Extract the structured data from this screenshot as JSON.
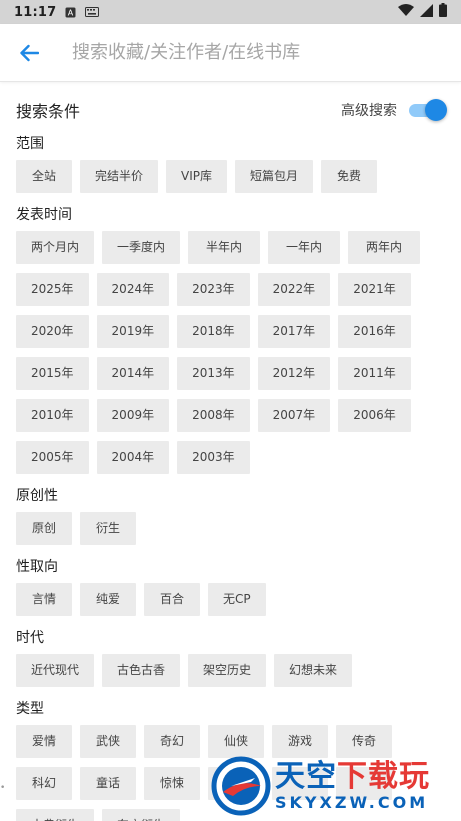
{
  "status_bar": {
    "time": "11:17"
  },
  "toolbar": {
    "search_placeholder": "搜索收藏/关注作者/在线书库"
  },
  "conditions": {
    "title": "搜索条件",
    "advanced_label": "高级搜索",
    "advanced_on": true
  },
  "sections": {
    "scope": {
      "title": "范围",
      "items": [
        "全站",
        "完结半价",
        "VIP库",
        "短篇包月",
        "免费"
      ]
    },
    "time": {
      "title": "发表时间",
      "items": [
        "两个月内",
        "一季度内",
        "半年内",
        "一年内",
        "两年内",
        "2025年",
        "2024年",
        "2023年",
        "2022年",
        "2021年",
        "2020年",
        "2019年",
        "2018年",
        "2017年",
        "2016年",
        "2015年",
        "2014年",
        "2013年",
        "2012年",
        "2011年",
        "2010年",
        "2009年",
        "2008年",
        "2007年",
        "2006年",
        "2005年",
        "2004年",
        "2003年"
      ]
    },
    "originality": {
      "title": "原创性",
      "items": [
        "原创",
        "衍生"
      ]
    },
    "orientation": {
      "title": "性取向",
      "items": [
        "言情",
        "纯爱",
        "百合",
        "无CP"
      ]
    },
    "era": {
      "title": "时代",
      "items": [
        "近代现代",
        "古色古香",
        "架空历史",
        "幻想未来"
      ]
    },
    "genre": {
      "title": "类型",
      "items": [
        "爱情",
        "武侠",
        "奇幻",
        "仙侠",
        "游戏",
        "传奇",
        "科幻",
        "童话",
        "惊悚",
        "",
        "",
        "",
        "古典衍生",
        "东方衍生"
      ]
    }
  },
  "watermark": {
    "cn_main": "天空",
    "cn_accent": "下载玩",
    "en": "SKYXZW.COM"
  },
  "colors": {
    "accent": "#1e88e5",
    "chip_bg": "#ebebeb",
    "status_bar": "#d4d4d4"
  }
}
